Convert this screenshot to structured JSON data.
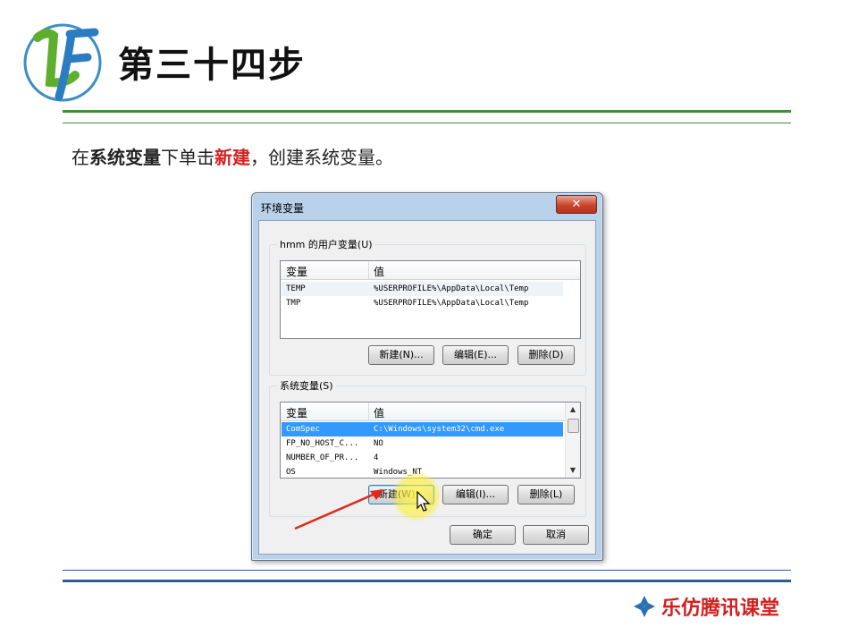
{
  "slide": {
    "title": "第三十四步",
    "instruction": {
      "p1": "在",
      "b1": "系统变量",
      "p2": "下单击",
      "r1": "新建",
      "p3": "，创建系统变量。"
    },
    "brand": "乐仿腾讯课堂",
    "logo_letters": "LF"
  },
  "dialog": {
    "title": "环境变量",
    "close_glyph": "✕",
    "user_vars": {
      "label": "hmm 的用户变量(U)",
      "col_variable": "变量",
      "col_value": "值",
      "rows": [
        {
          "name": "TEMP",
          "value": "%USERPROFILE%\\AppData\\Local\\Temp"
        },
        {
          "name": "TMP",
          "value": "%USERPROFILE%\\AppData\\Local\\Temp"
        }
      ],
      "new_btn": "新建(N)...",
      "edit_btn": "编辑(E)...",
      "delete_btn": "删除(D)"
    },
    "system_vars": {
      "label": "系统变量(S)",
      "col_variable": "变量",
      "col_value": "值",
      "rows": [
        {
          "name": "ComSpec",
          "value": "C:\\Windows\\system32\\cmd.exe"
        },
        {
          "name": "FP_NO_HOST_C...",
          "value": "NO"
        },
        {
          "name": "NUMBER_OF_PR...",
          "value": "4"
        },
        {
          "name": "OS",
          "value": "Windows_NT"
        }
      ],
      "new_btn": "新建(W)...",
      "edit_btn": "编辑(I)...",
      "delete_btn": "删除(L)"
    },
    "ok_btn": "确定",
    "cancel_btn": "取消"
  },
  "colors": {
    "accent_green": "#3f8f3a",
    "accent_blue": "#2d5d94",
    "emphasis_red": "#d51f1f",
    "selection_blue": "#3399ff"
  },
  "icons": [
    "logo-lf-icon",
    "close-icon",
    "scroll-up-icon",
    "scroll-down-icon",
    "mouse-cursor-icon",
    "annotation-arrow-icon",
    "brand-diamond-icon"
  ]
}
